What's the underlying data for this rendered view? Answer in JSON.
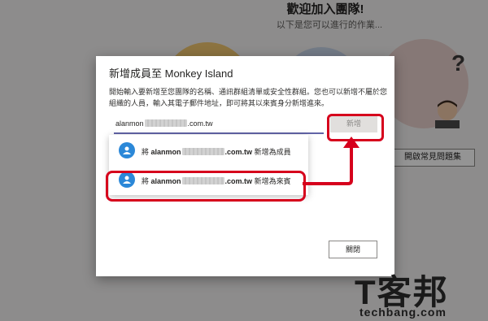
{
  "background": {
    "title": "歡迎加入團隊!",
    "subtitle": "以下是您可以進行的作業...",
    "side_button": "開啟常見問題集",
    "question_mark": "?"
  },
  "dialog": {
    "title": "新增成員至 Monkey Island",
    "description": "開始輸入要新增至您團隊的名稱、通訊群組清單或安全性群組。您也可以新增不屬於您組織的人員，輸入其電子郵件地址，即可將其以來賓身分新增進來。",
    "input_value_prefix": "alanmon",
    "input_value_suffix": ".com.tw",
    "add_button": "新增",
    "close_button": "關閉",
    "suggestions": [
      {
        "prefix": "將",
        "email_prefix": "alanmon",
        "email_suffix": ".com.tw",
        "suffix": "新增為成員"
      },
      {
        "prefix": "將",
        "email_prefix": "alanmon",
        "email_suffix": ".com.tw",
        "suffix": "新增為來賓"
      }
    ]
  },
  "watermark": {
    "brand_cn": "T客邦",
    "brand_en": "techbang.com"
  },
  "colors": {
    "accent": "#6264a7",
    "highlight": "#d6001c",
    "avatar": "#2b88d8"
  }
}
